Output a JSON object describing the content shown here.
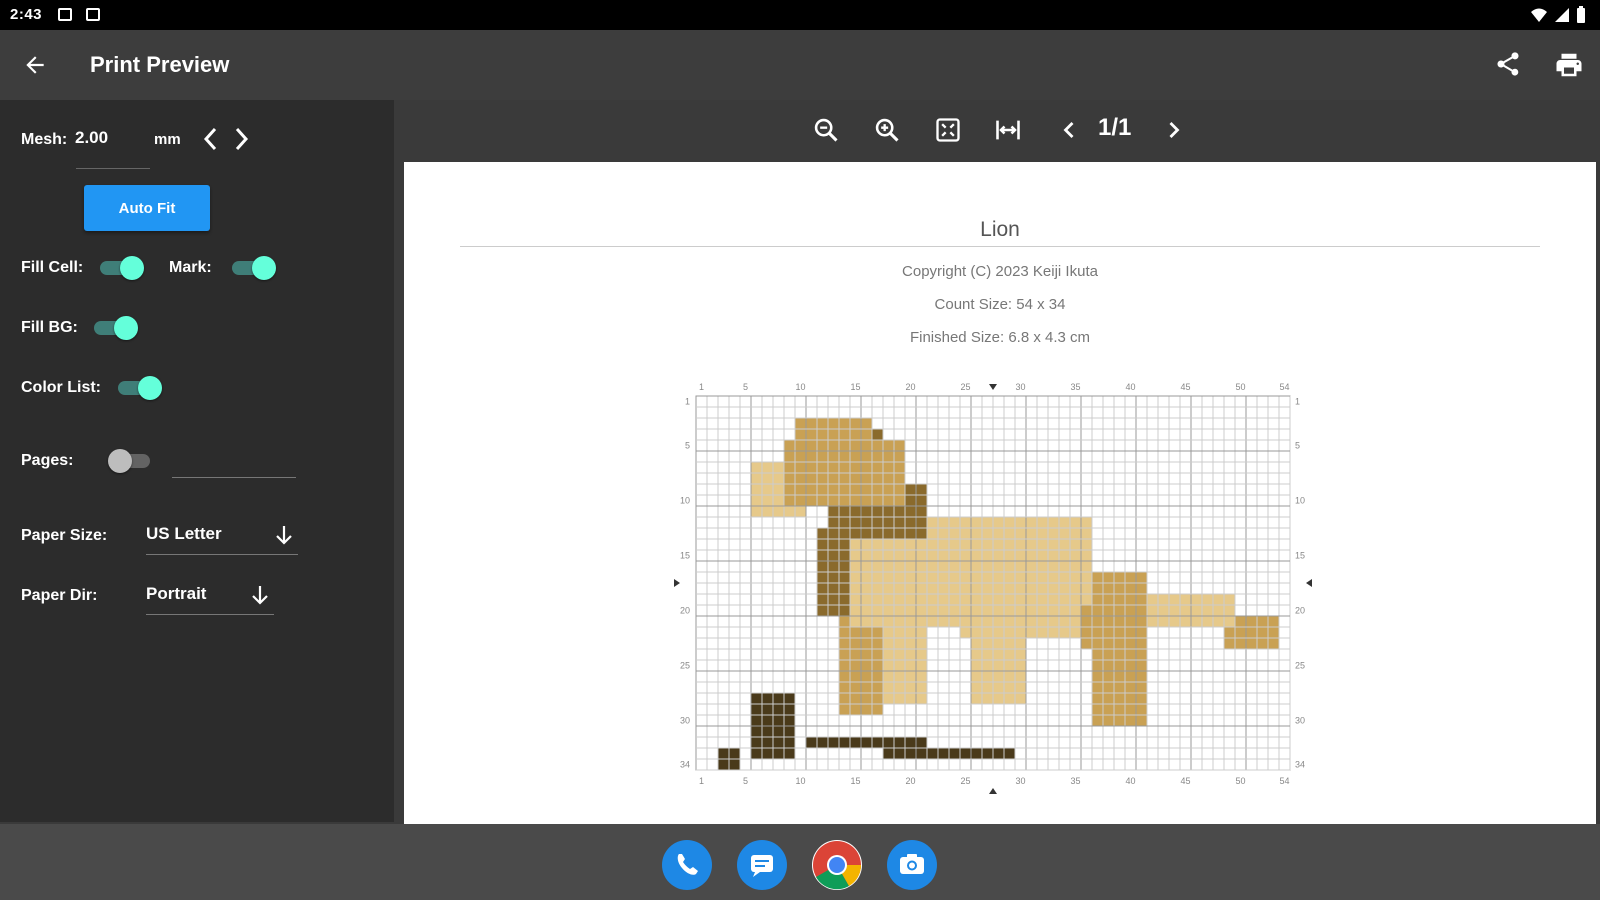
{
  "status": {
    "time": "2:43"
  },
  "appbar": {
    "title": "Print Preview"
  },
  "sidebar": {
    "mesh_label": "Mesh:",
    "mesh_value": "2.00",
    "mesh_unit": "mm",
    "autofit_label": "Auto Fit",
    "fill_cell_label": "Fill Cell:",
    "mark_label": "Mark:",
    "fill_bg_label": "Fill BG:",
    "color_list_label": "Color List:",
    "pages_label": "Pages:",
    "paper_size_label": "Paper Size:",
    "paper_size_value": "US Letter",
    "paper_dir_label": "Paper Dir:",
    "paper_dir_value": "Portrait"
  },
  "toolbar": {
    "page_indicator": "1/1"
  },
  "preview": {
    "title": "Lion",
    "copyright": "Copyright (C) 2023 Keiji Ikuta",
    "count_size": "Count Size: 54 x 34",
    "finished_size": "Finished Size: 6.8 x 4.3 cm",
    "x_ticks": [
      "1",
      "5",
      "10",
      "15",
      "20",
      "25",
      "30",
      "35",
      "40",
      "45",
      "50",
      "54"
    ],
    "y_ticks": [
      "1",
      "5",
      "10",
      "15",
      "20",
      "25",
      "30",
      "34"
    ]
  },
  "colors": {
    "accent": "#2196f3",
    "switch_on": "#64ffda",
    "lion_light": "#e6c98a",
    "lion_mid": "#c9a154",
    "lion_dark": "#8a6a2c",
    "lion_darkest": "#4a3a1a"
  }
}
